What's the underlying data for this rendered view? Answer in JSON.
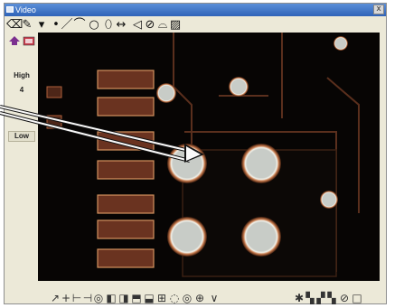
{
  "window": {
    "title": "Video",
    "close_glyph": "x"
  },
  "toolbar_top": {
    "tools": [
      {
        "name": "eraser-tool-icon",
        "glyph": "⌫"
      },
      {
        "name": "pencil-tool-icon",
        "glyph": "✎"
      },
      {
        "name": "vacuum-tool-icon",
        "glyph": "▾"
      },
      {
        "name": "point-tool-icon",
        "glyph": "•"
      },
      {
        "name": "line-tool-icon",
        "glyph": "／"
      },
      {
        "name": "arc-tool-icon",
        "glyph": "⌒"
      },
      {
        "name": "circle-tool-icon",
        "glyph": "○"
      },
      {
        "name": "slot-tool-icon",
        "glyph": "⬯"
      },
      {
        "name": "distance-tool-icon",
        "glyph": "↔"
      },
      {
        "name": "angle-tool-icon",
        "glyph": "◁"
      },
      {
        "name": "lasso-tool-icon",
        "glyph": "⊘"
      },
      {
        "name": "blob-tool-icon",
        "glyph": "⌓"
      },
      {
        "name": "image-tool-icon",
        "glyph": "▨"
      }
    ]
  },
  "sidebar": {
    "zoom_icon": "zoom-icon",
    "settings_icon": "settings-icon",
    "high_label": "High",
    "level_value": "4",
    "low_label": "Low"
  },
  "toolbar_bottom": {
    "tools": [
      {
        "name": "probe-tool-icon",
        "glyph": "↗"
      },
      {
        "name": "crosshair-icon",
        "glyph": "+"
      },
      {
        "name": "edge-left-icon",
        "glyph": "⊢"
      },
      {
        "name": "edge-right-icon",
        "glyph": "⊣"
      },
      {
        "name": "target-icon",
        "glyph": "◎"
      },
      {
        "name": "box-left-icon",
        "glyph": "◧"
      },
      {
        "name": "box-right-icon",
        "glyph": "◨"
      },
      {
        "name": "box-top-icon",
        "glyph": "⬒"
      },
      {
        "name": "box-bottom-icon",
        "glyph": "⬓"
      },
      {
        "name": "box-grid-icon",
        "glyph": "⊞"
      },
      {
        "name": "lasso-icon",
        "glyph": "◌"
      },
      {
        "name": "ring-icon",
        "glyph": "◎"
      },
      {
        "name": "focus-icon",
        "glyph": "⊕"
      },
      {
        "name": "dropdown-icon",
        "glyph": "∨"
      },
      {
        "name": "illumination-icon",
        "glyph": "✱"
      },
      {
        "name": "pattern-a-icon",
        "glyph": "▚"
      },
      {
        "name": "pattern-b-icon",
        "glyph": "▞"
      },
      {
        "name": "pattern-c-icon",
        "glyph": "▚"
      },
      {
        "name": "no-entry-icon",
        "glyph": "⊘"
      },
      {
        "name": "blank-icon",
        "glyph": "□"
      }
    ]
  },
  "colors": {
    "viewport_bg": "#050403",
    "copper": "#b0603a",
    "copper_bright": "#e6b08a",
    "pad_fill": "#c8ccc7",
    "accent": "#2f63b8"
  }
}
